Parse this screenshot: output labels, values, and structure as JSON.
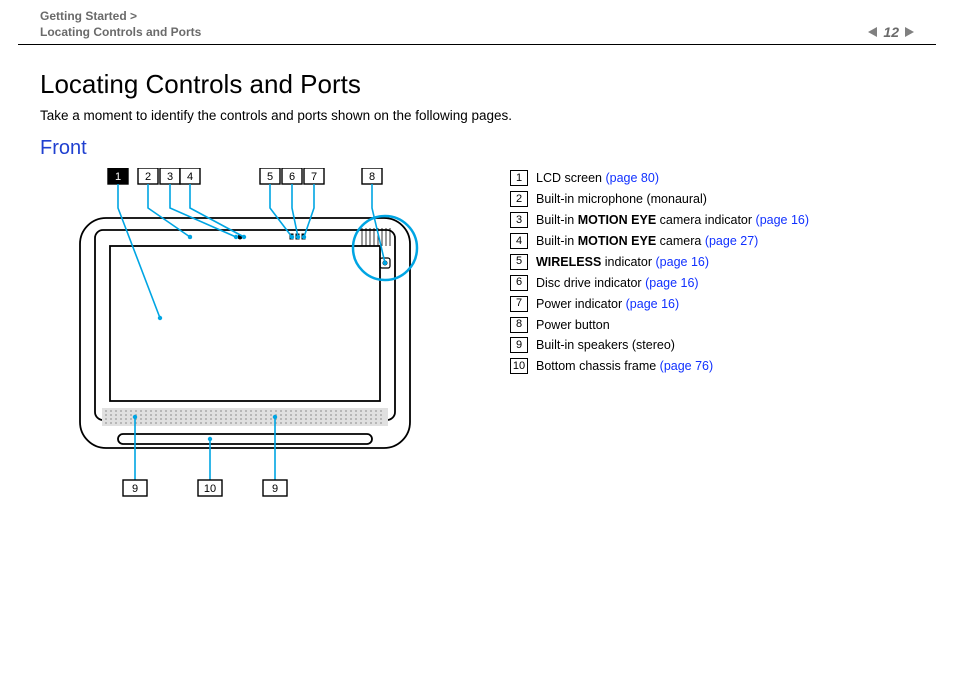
{
  "header": {
    "breadcrumb1": "Getting Started >",
    "breadcrumb2": "Locating Controls and Ports",
    "page_number": "12"
  },
  "title": "Locating Controls and Ports",
  "intro": "Take a moment to identify the controls and ports shown on the following pages.",
  "section": "Front",
  "figure": {
    "top_callouts": [
      "1",
      "2",
      "3",
      "4",
      "5",
      "6",
      "7",
      "8"
    ],
    "bottom_callouts": [
      "9",
      "10",
      "9"
    ]
  },
  "legend": [
    {
      "num": "1",
      "pre": "LCD screen ",
      "bold": "",
      "post": "",
      "link": "(page 80)"
    },
    {
      "num": "2",
      "pre": "Built-in microphone (monaural)",
      "bold": "",
      "post": "",
      "link": ""
    },
    {
      "num": "3",
      "pre": "Built-in ",
      "bold": "MOTION EYE",
      "post": " camera indicator ",
      "link": "(page 16)"
    },
    {
      "num": "4",
      "pre": "Built-in ",
      "bold": "MOTION EYE",
      "post": " camera ",
      "link": "(page 27)"
    },
    {
      "num": "5",
      "pre": "",
      "bold": "WIRELESS",
      "post": " indicator ",
      "link": "(page 16)"
    },
    {
      "num": "6",
      "pre": "Disc drive indicator ",
      "bold": "",
      "post": "",
      "link": "(page 16)"
    },
    {
      "num": "7",
      "pre": "Power indicator ",
      "bold": "",
      "post": "",
      "link": "(page 16)"
    },
    {
      "num": "8",
      "pre": "Power button",
      "bold": "",
      "post": "",
      "link": ""
    },
    {
      "num": "9",
      "pre": "Built-in speakers (stereo)",
      "bold": "",
      "post": "",
      "link": ""
    },
    {
      "num": "10",
      "pre": "Bottom chassis frame ",
      "bold": "",
      "post": "",
      "link": "(page 76)"
    }
  ]
}
